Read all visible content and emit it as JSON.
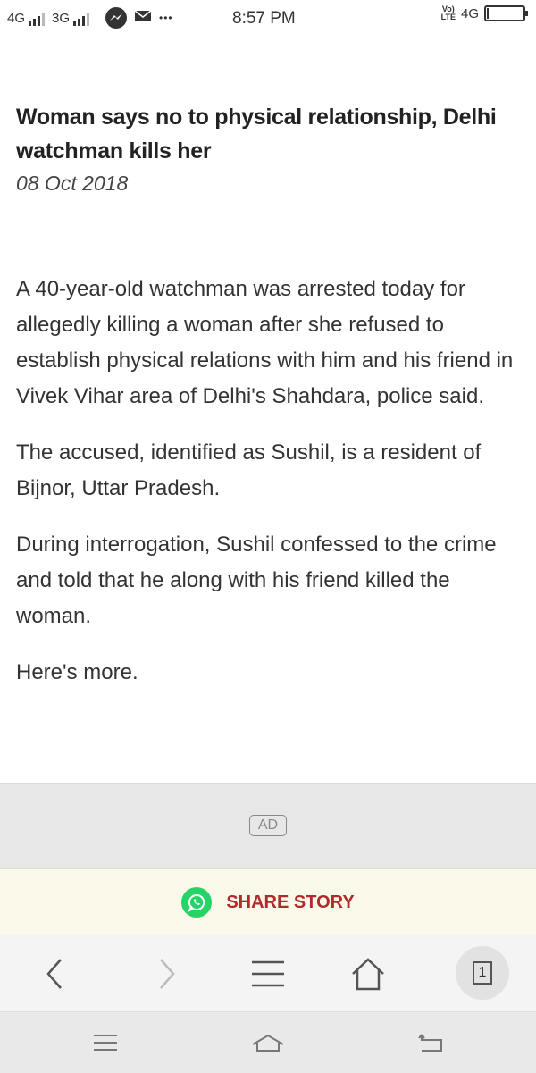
{
  "status_bar": {
    "sim1": "4G",
    "sim2": "3G",
    "more": "•••",
    "time": "8:57 PM",
    "volte": "Vo)\nLTE",
    "network_right": "4G",
    "battery_level": 0.03,
    "icons": [
      "signal-icon",
      "messenger-icon",
      "mail-icon",
      "battery-icon"
    ]
  },
  "article": {
    "headline": "Woman says no to physical relationship, Delhi watchman kills her",
    "date": "08 Oct 2018",
    "paragraphs": [
      "A 40-year-old watchman was arrested today for allegedly killing a woman after she refused to establish physical relations with him and his friend in Vivek Vihar area of Delhi's Shahdara, police said.",
      "The accused, identified as Sushil, is a resident of Bijnor, Uttar Pradesh.",
      "During interrogation, Sushil confessed to the crime and told that he along with his friend killed the woman.",
      "Here's more."
    ]
  },
  "ad": {
    "label": "AD"
  },
  "share": {
    "label": "SHARE STORY",
    "icon": "whatsapp-icon",
    "color": "#b02c2c"
  },
  "toolbar": {
    "tab_count": "1",
    "icons": [
      "back-icon",
      "forward-icon",
      "menu-icon",
      "home-icon",
      "tabs-icon"
    ]
  },
  "navbar": {
    "icons": [
      "recents-icon",
      "home-icon",
      "back-icon"
    ]
  }
}
